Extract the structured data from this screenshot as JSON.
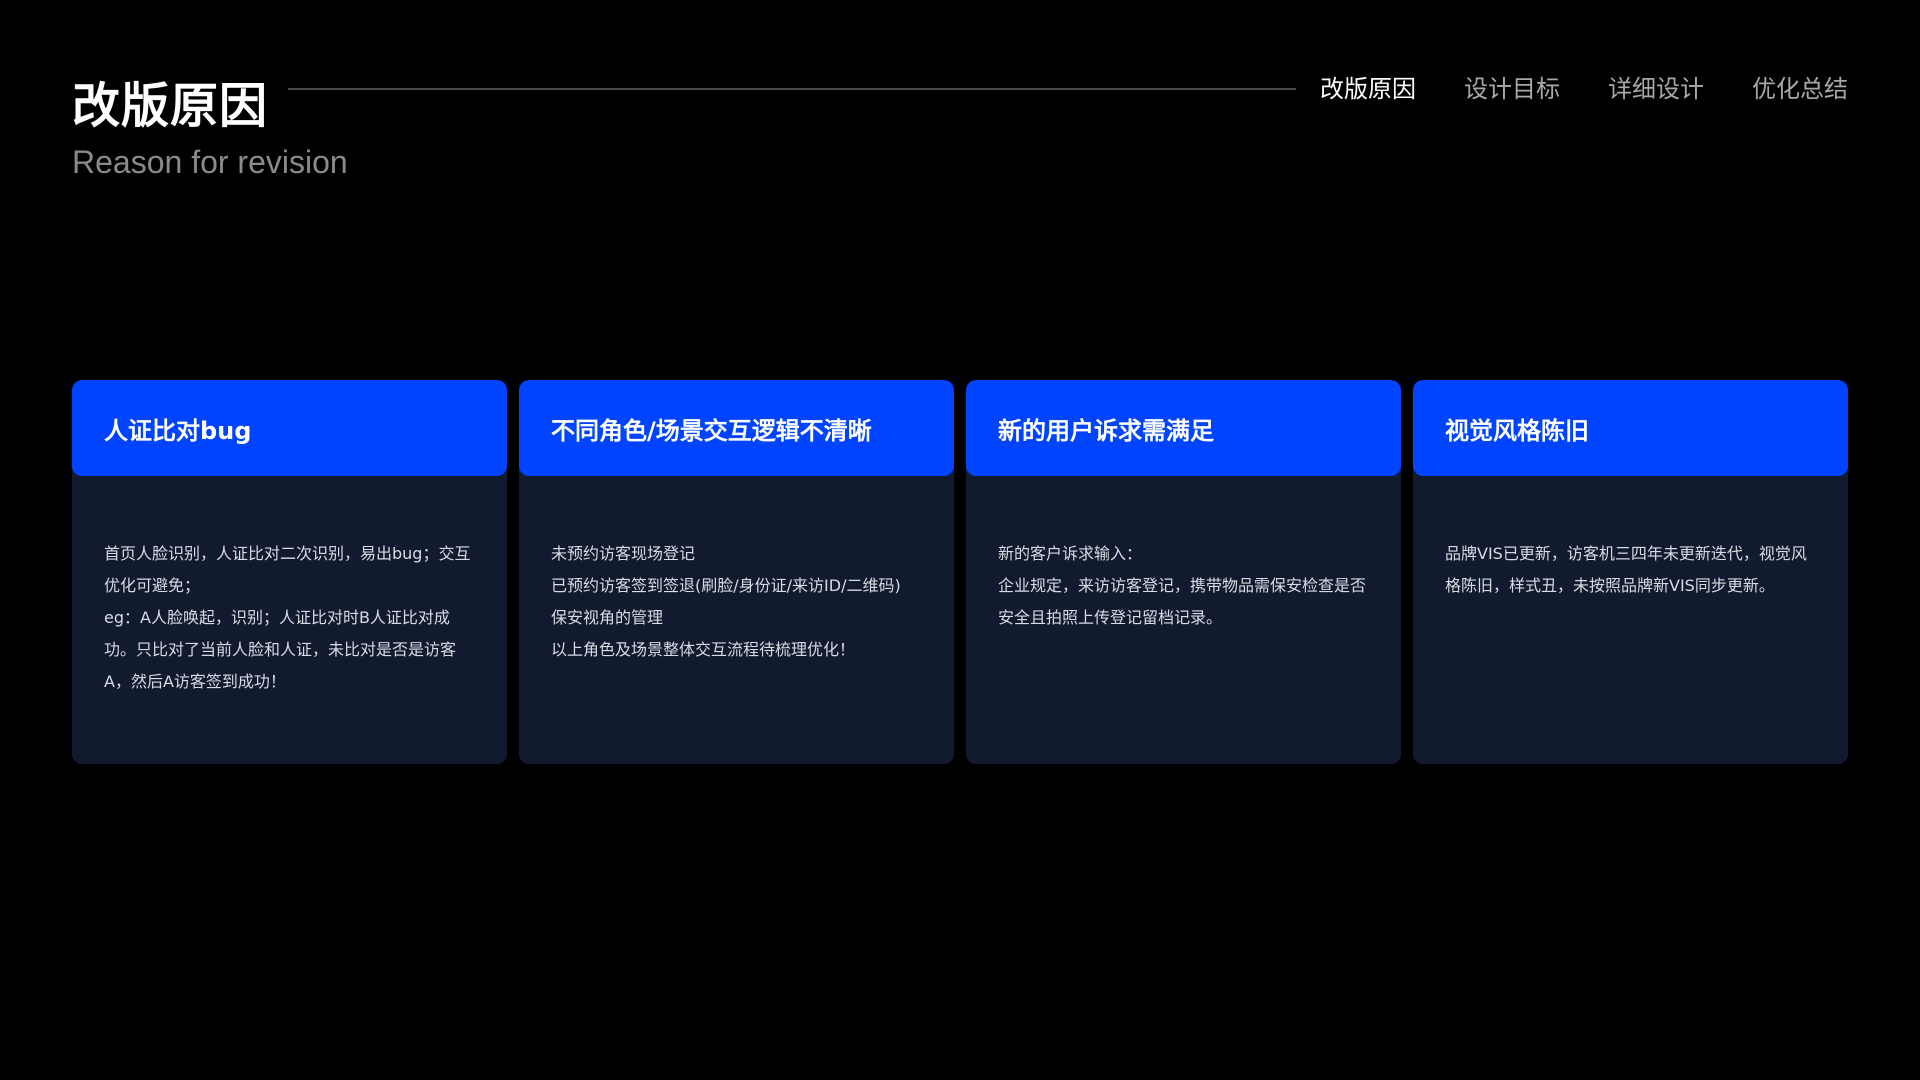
{
  "header": {
    "title": "改版原因",
    "subtitle": "Reason for revision"
  },
  "nav": {
    "items": [
      {
        "label": "改版原因",
        "active": true
      },
      {
        "label": "设计目标",
        "active": false
      },
      {
        "label": "详细设计",
        "active": false
      },
      {
        "label": "优化总结",
        "active": false
      }
    ]
  },
  "colors": {
    "background": "#000000",
    "accent_blue": "#0044ff",
    "card_body": "#111a2e",
    "subtitle_gray": "#8a8a8a"
  },
  "cards": [
    {
      "title": "人证比对bug",
      "lines": [
        "首页人脸识别，人证比对二次识别，易出bug；交互",
        "优化可避免；",
        "eg：A人脸唤起，识别；人证比对时B人证比对成",
        "功。只比对了当前人脸和人证，未比对是否是访客",
        "A，然后A访客签到成功！"
      ]
    },
    {
      "title": "不同角色/场景交互逻辑不清晰",
      "lines": [
        "未预约访客现场登记",
        "已预约访客签到签退(刷脸/身份证/来访ID/二维码)",
        "保安视角的管理",
        "以上角色及场景整体交互流程待梳理优化！"
      ]
    },
    {
      "title": "新的用户诉求需满足",
      "lines": [
        "新的客户诉求输入：",
        "企业规定，来访访客登记，携带物品需保安检查是否",
        "安全且拍照上传登记留档记录。"
      ]
    },
    {
      "title": "视觉风格陈旧",
      "lines": [
        "品牌VIS已更新，访客机三四年未更新迭代，视觉风",
        "格陈旧，样式丑，未按照品牌新VIS同步更新。"
      ]
    }
  ]
}
